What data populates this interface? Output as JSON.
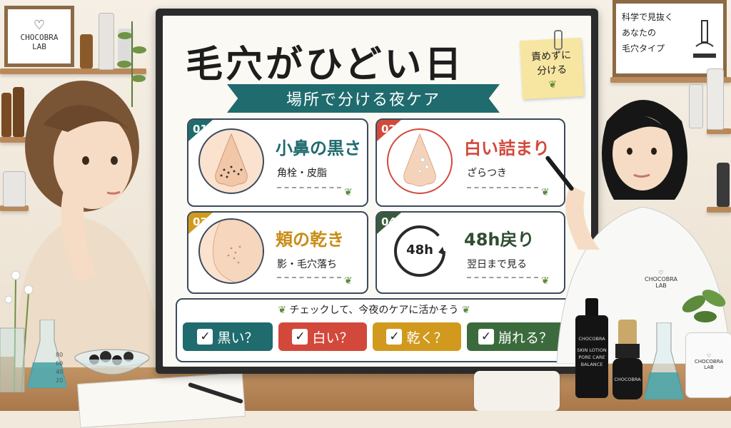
{
  "headline": "毛穴がひどい日",
  "ribbon": "場所で分ける夜ケア",
  "sticky_note": {
    "line1": "責めずに",
    "line2": "分ける"
  },
  "left_frame": {
    "line1": "CHOCOBRA",
    "line2": "LAB"
  },
  "right_frame": {
    "line1": "科学で見抜く",
    "line2": "あなたの",
    "line3": "毛穴タイプ"
  },
  "cards": [
    {
      "num": "01",
      "title": "小鼻の黒さ",
      "sub": "角栓・皮脂",
      "color": "#1f6b6e",
      "title_color": "#1f6b6e"
    },
    {
      "num": "02",
      "title": "白い詰まり",
      "sub": "ざらつき",
      "color": "#d2493b",
      "title_color": "#d2493b"
    },
    {
      "num": "03",
      "title": "頬の乾き",
      "sub": "影・毛穴落ち",
      "color": "#d19a1e",
      "title_color": "#c98c14"
    },
    {
      "num": "04",
      "title": "48h戻り",
      "sub": "翌日まで見る",
      "color": "#3b5a3c",
      "title_color": "#2f4d30",
      "clock_label": "48h"
    }
  ],
  "check_heading": "チェックして、今夜のケアに活かそう",
  "check_buttons": [
    {
      "label": "黒い？",
      "color": "#1f6b6e"
    },
    {
      "label": "白い？",
      "color": "#d2493b"
    },
    {
      "label": "乾く？",
      "color": "#d19a1e"
    },
    {
      "label": "崩れる？",
      "color": "#3b6b3d"
    }
  ],
  "check_mark": "✓",
  "coat_logo": {
    "line1": "CHOCOBRA",
    "line2": "LAB"
  },
  "pot_logo": {
    "line1": "CHOCOBRA",
    "line2": "LAB"
  },
  "bottle_label": {
    "brand": "CHOCOBRA",
    "line1": "SKIN LOTION",
    "line2": "PORE CARE",
    "line3": "BALANCE"
  },
  "jar_label": "CHOCOBRA",
  "beaker_marks": [
    "80",
    "60",
    "40",
    "20"
  ]
}
